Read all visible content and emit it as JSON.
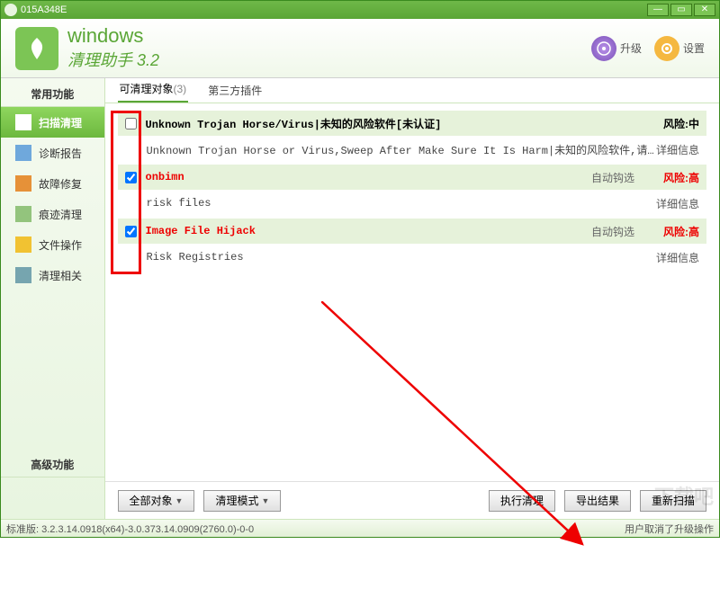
{
  "titlebar": {
    "title": "015A348E"
  },
  "header": {
    "app_name": "windows",
    "app_sub": "清理助手 3.2",
    "upgrade": "升级",
    "settings": "设置"
  },
  "sidebar": {
    "common_header": "常用功能",
    "advanced_header": "高级功能",
    "items": [
      {
        "label": "扫描清理"
      },
      {
        "label": "诊断报告"
      },
      {
        "label": "故障修复"
      },
      {
        "label": "痕迹清理"
      },
      {
        "label": "文件操作"
      },
      {
        "label": "清理相关"
      }
    ]
  },
  "tabs": {
    "t0_label": "可清理对象",
    "t0_count": "(3)",
    "t1_label": "第三方插件"
  },
  "items": [
    {
      "checked": false,
      "title": "Unknown Trojan Horse/Virus|未知的风险软件[未认证]",
      "title_color": "black",
      "auto": "",
      "risk": "风险:中",
      "risk_level": "mid",
      "desc": "Unknown Trojan Horse or Virus,Sweep After Make Sure It Is Harm|未知的风险软件,请确认...",
      "detail": "详细信息"
    },
    {
      "checked": true,
      "title": "onbimn",
      "title_color": "red",
      "auto": "自动钩选",
      "risk": "风险:高",
      "risk_level": "high",
      "desc": "risk files",
      "detail": "详细信息"
    },
    {
      "checked": true,
      "title": "Image File Hijack",
      "title_color": "red",
      "auto": "自动钩选",
      "risk": "风险:高",
      "risk_level": "high",
      "desc": "Risk Registries",
      "detail": "详细信息"
    }
  ],
  "bottom": {
    "all": "全部对象",
    "mode": "清理模式",
    "execute": "执行清理",
    "export": "导出结果",
    "rescan": "重新扫描"
  },
  "statusbar": {
    "version": "标准版: 3.2.3.14.0918(x64)-3.0.373.14.0909(2760.0)-0-0",
    "msg": "用户取消了升级操作"
  },
  "watermark": "下载吧"
}
